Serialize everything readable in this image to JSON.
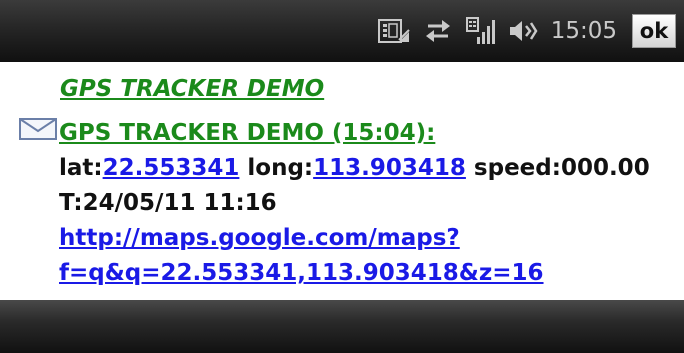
{
  "status_bar": {
    "icons": [
      "network-icon",
      "data-transfer-icon",
      "signal-strength-icon",
      "speaker-icon"
    ],
    "time": "15:05",
    "ok_label": "ok"
  },
  "message": {
    "sender": "GPS TRACKER DEMO",
    "title": "GPS TRACKER DEMO (15:04):",
    "lat_label": "lat:",
    "lat_value": "22.553341",
    "long_label": "long:",
    "long_value": "113.903418",
    "speed_label": "speed:",
    "speed_value": "000.00",
    "timestamp": "T:24/05/11 11:16",
    "map_link_line1": "http://maps.google.com/maps?",
    "map_link_line2": "f=q&q=22.553341,113.903418&z=16"
  },
  "colors": {
    "sender_green": "#1b8a1b",
    "link_blue": "#1a1ae6",
    "bar_dark": "#1a1a1a"
  }
}
